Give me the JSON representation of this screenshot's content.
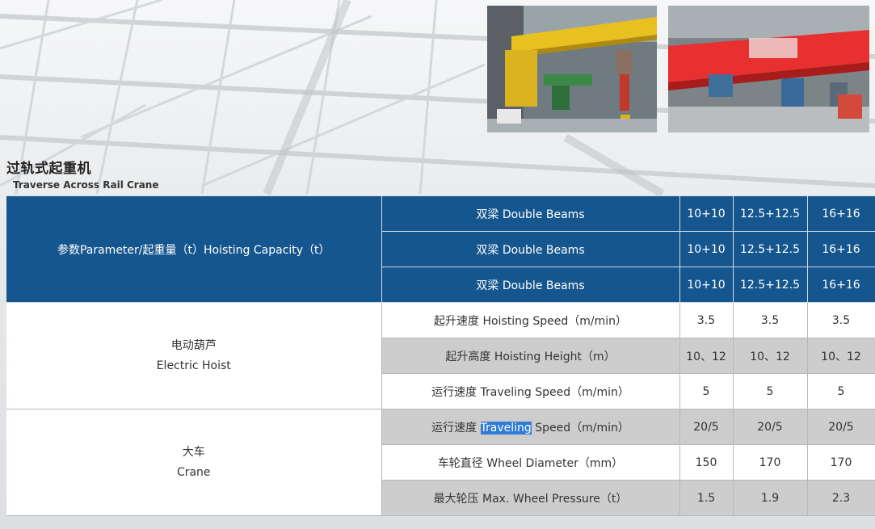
{
  "title": {
    "cn": "过轨式起重机",
    "en": "Traverse Across Rail Crane"
  },
  "photos": [
    {
      "name": "yellow-crane-photo",
      "main_color": "#e8c020"
    },
    {
      "name": "red-crane-photo",
      "main_color": "#e83030"
    }
  ],
  "table": {
    "param_label": "参数Parameter/起重量（t）Hoisting Capacity（t）",
    "header_rows": [
      {
        "label": "双梁 Double Beams",
        "values": [
          "10+10",
          "12.5+12.5",
          "16+16"
        ]
      },
      {
        "label": "双梁 Double Beams",
        "values": [
          "10+10",
          "12.5+12.5",
          "16+16"
        ]
      },
      {
        "label": "双梁 Double Beams",
        "values": [
          "10+10",
          "12.5+12.5",
          "16+16"
        ]
      }
    ],
    "groups": [
      {
        "cn": "电动葫芦",
        "en": "Electric Hoist",
        "rows": [
          {
            "label": "起升速度 Hoisting Speed（m/min）",
            "values": [
              "3.5",
              "3.5",
              "3.5"
            ]
          },
          {
            "label": "起升高度 Hoisting Height（m）",
            "values": [
              "10、12",
              "10、12",
              "10、12"
            ]
          },
          {
            "label": "运行速度 Traveling Speed（m/min）",
            "values": [
              "5",
              "5",
              "5"
            ]
          }
        ]
      },
      {
        "cn": "大车",
        "en": "Crane",
        "rows": [
          {
            "label_prefix": "运行速度 ",
            "label_highlight": "Traveling",
            "label_suffix": " Speed（m/min）",
            "values": [
              "20/5",
              "20/5",
              "20/5"
            ]
          },
          {
            "label": "车轮直径 Wheel Diameter（mm）",
            "values": [
              "150",
              "170",
              "170"
            ]
          },
          {
            "label": "最大轮压 Max. Wheel Pressure（t）",
            "values": [
              "1.5",
              "1.9",
              "2.3"
            ]
          }
        ]
      }
    ]
  }
}
